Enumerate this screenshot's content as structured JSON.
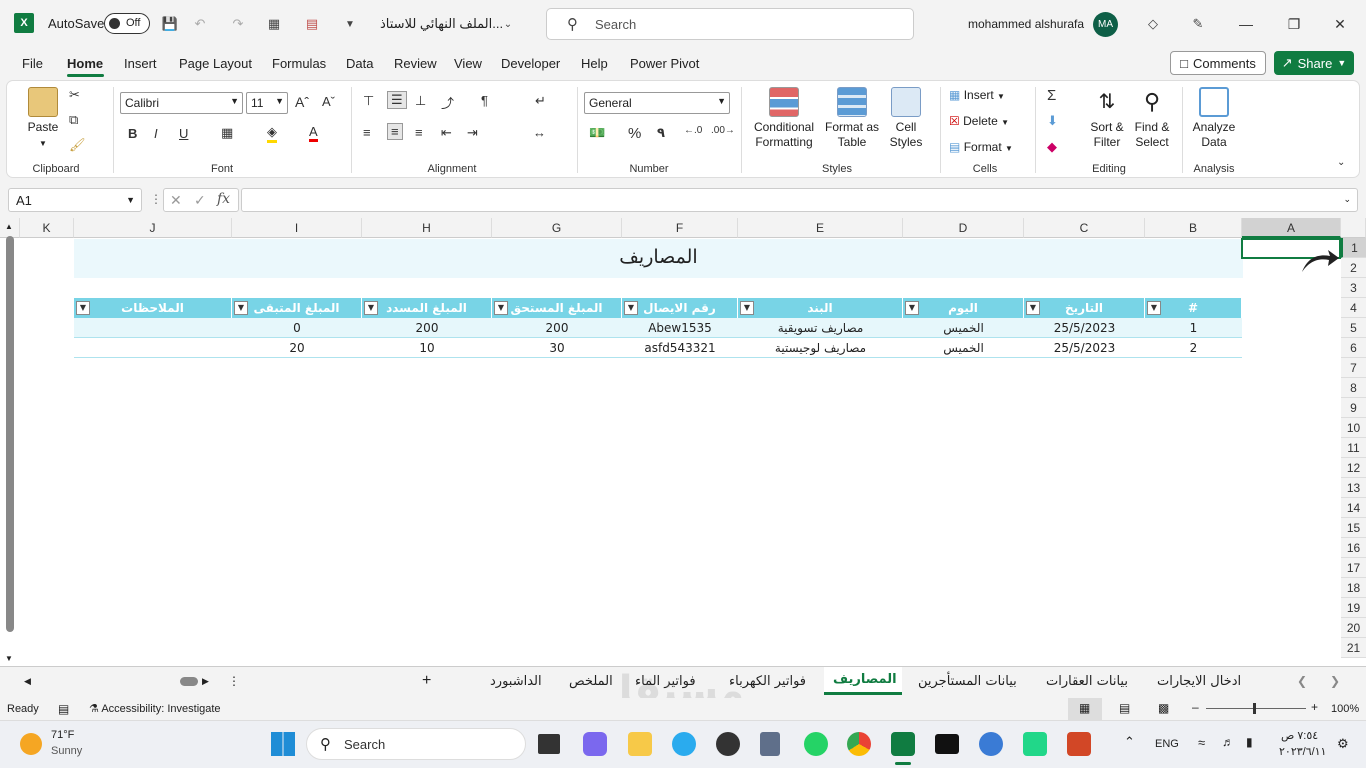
{
  "titlebar": {
    "autosave_label": "AutoSave",
    "autosave_state": "Off",
    "document_title": "الملف النهائي للاستاذ...",
    "search_placeholder": "Search",
    "user_name": "mohammed alshurafa",
    "user_initials": "MA"
  },
  "menu_tabs": [
    "File",
    "Home",
    "Insert",
    "Page Layout",
    "Formulas",
    "Data",
    "Review",
    "View",
    "Developer",
    "Help",
    "Power Pivot"
  ],
  "active_menu_tab": "Home",
  "comments_label": "Comments",
  "share_label": "Share",
  "ribbon": {
    "clipboard": {
      "paste": "Paste",
      "label": "Clipboard"
    },
    "font": {
      "name": "Calibri",
      "size": "11",
      "label": "Font",
      "bold": "B",
      "italic": "I",
      "underline": "U"
    },
    "alignment": {
      "label": "Alignment"
    },
    "number": {
      "format": "General",
      "label": "Number"
    },
    "styles": {
      "conditional_1": "Conditional",
      "conditional_2": "Formatting",
      "format_table_1": "Format as",
      "format_table_2": "Table",
      "cell_styles_1": "Cell",
      "cell_styles_2": "Styles",
      "label": "Styles"
    },
    "cells": {
      "insert": "Insert",
      "delete": "Delete",
      "format": "Format",
      "label": "Cells"
    },
    "editing": {
      "sort_1": "Sort &",
      "sort_2": "Filter",
      "find_1": "Find &",
      "find_2": "Select",
      "label": "Editing"
    },
    "analysis": {
      "analyze_1": "Analyze",
      "analyze_2": "Data",
      "label": "Analysis"
    }
  },
  "formula_bar": {
    "name_box": "A1",
    "fx": "fx",
    "formula": ""
  },
  "columns": [
    "K",
    "J",
    "I",
    "H",
    "G",
    "F",
    "E",
    "D",
    "C",
    "B",
    "A"
  ],
  "rows": [
    "1",
    "2",
    "3",
    "4",
    "5",
    "6",
    "7",
    "8",
    "9",
    "10",
    "11",
    "12",
    "13",
    "14",
    "15",
    "16",
    "17",
    "18",
    "19",
    "20",
    "21"
  ],
  "sheet": {
    "title": "المصاريف",
    "headers": [
      "#",
      "التاريخ",
      "اليوم",
      "البند",
      "رقم الايصال",
      "المبلغ المستحق",
      "المبلغ المسدد",
      "المبلغ المتبقى",
      "الملاحظات"
    ],
    "rows": [
      [
        "1",
        "25/5/2023",
        "الخميس",
        "مصاريف تسويقية",
        "Abew1535",
        "200",
        "200",
        "0",
        ""
      ],
      [
        "2",
        "25/5/2023",
        "الخميس",
        "مصاريف لوجيستية",
        "asfd543321",
        "30",
        "10",
        "20",
        ""
      ]
    ]
  },
  "sheet_tabs": [
    "ادخال الايجارات",
    "بيانات العقارات",
    "بيانات المستأجرين",
    "المصاريف",
    "فواتير الكهرباء",
    "فواتير الماء",
    "الملخص",
    "الداشبورد"
  ],
  "active_sheet": "المصاريف",
  "status": {
    "ready": "Ready",
    "accessibility": "Accessibility: Investigate",
    "zoom": "100%"
  },
  "taskbar": {
    "weather_temp": "71°F",
    "weather_desc": "Sunny",
    "search": "Search",
    "lang": "ENG",
    "time": "٧:٥٤ ص",
    "date": "٢٠٢٣/٦/١١"
  },
  "watermark": "مستقل",
  "colors": {
    "accent": "#107c41",
    "table_header": "#78d4e6",
    "band": "#e6f7fb"
  }
}
